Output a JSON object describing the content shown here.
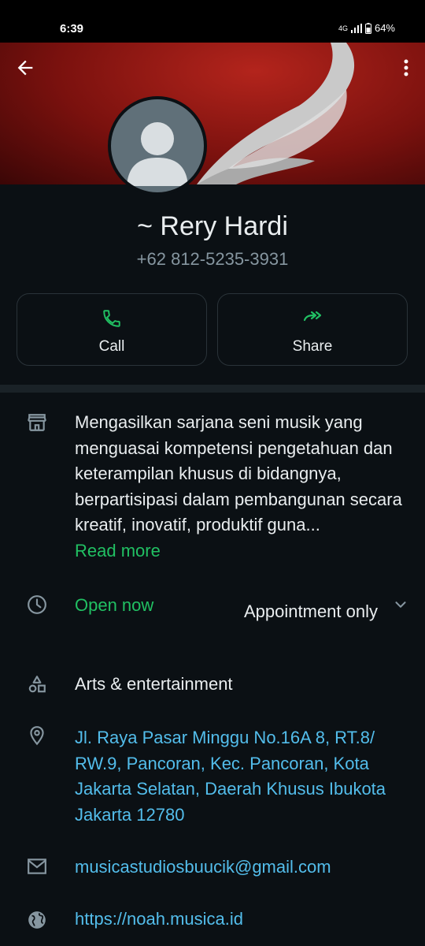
{
  "status_bar": {
    "time": "6:39",
    "network": "4G",
    "battery": "64%"
  },
  "profile": {
    "name": "~ Rery Hardi",
    "phone": "+62 812-5235-3931"
  },
  "actions": {
    "call_label": "Call",
    "share_label": "Share",
    "accent_color": "#21c063"
  },
  "business": {
    "description": "Mengasilkan sarjana seni musik yang menguasai kompetensi pengetahuan dan keterampilan khusus di bidangnya, berpartisipasi dalam pembangunan secara kreatif, inovatif, produktif guna...",
    "read_more": "Read more",
    "hours_status": "Open now",
    "hours_detail": "Appointment only",
    "category": "Arts & entertainment",
    "address": "Jl. Raya Pasar Minggu No.16A 8, RT.8/ RW.9, Pancoran, Kec. Pancoran, Kota Jakarta Selatan, Daerah Khusus Ibukota Jakarta 12780",
    "email": "musicastudiosbuucik@gmail.com",
    "website": "https://noah.musica.id"
  },
  "icons": {
    "back": "arrow-back-icon",
    "more": "more-vert-icon",
    "call": "phone-icon",
    "share": "share-forward-icon",
    "store": "store-icon",
    "clock": "clock-icon",
    "category": "shapes-icon",
    "location": "location-pin-icon",
    "email": "mail-icon",
    "website": "globe-icon"
  },
  "colors": {
    "background": "#0b1014",
    "link": "#53bdeb",
    "accent": "#21c063",
    "secondary_text": "#8696a0"
  }
}
